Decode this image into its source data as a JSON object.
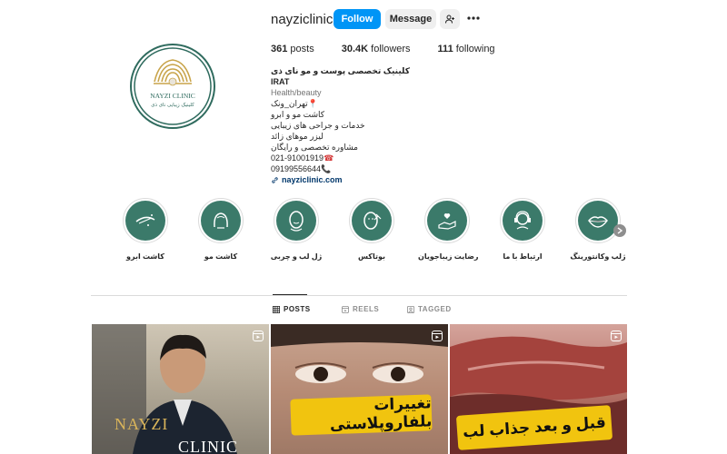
{
  "profile": {
    "username": "nayziclinic",
    "follow_label": "Follow",
    "message_label": "Message"
  },
  "stats": {
    "posts_num": "361",
    "posts_label": "posts",
    "followers_num": "30.4K",
    "followers_label": "followers",
    "following_num": "111",
    "following_label": "following"
  },
  "avatar": {
    "logo_line1": "NAYZI CLINIC",
    "logo_line2": "کلینیک زیبایی نای ذی"
  },
  "bio": {
    "name": "کلینیک تخصصی پوست و مو نای ذی IRAT",
    "category": "Health/beauty",
    "lines": [
      "تهران_ونک",
      "کاشت مو و ابرو",
      "خدمات و جراحی های زیبایی",
      "لیزر موهای زائد",
      "مشاوره تخصصی و رایگان",
      "021-91001919",
      "09199556644"
    ],
    "pin_emoji": "📍",
    "phone_emoji_1": "☎",
    "phone_emoji_2": "📞",
    "link": "nayziclinic.com"
  },
  "highlights": [
    {
      "label": "کاشت ابرو",
      "icon": "eyebrow-icon"
    },
    {
      "label": "کاشت مو",
      "icon": "hair-icon"
    },
    {
      "label": "ژل لب و چربی",
      "icon": "face-icon"
    },
    {
      "label": "بوتاکس",
      "icon": "botox-icon"
    },
    {
      "label": "رضایت زیباجویان",
      "icon": "hand-heart-icon"
    },
    {
      "label": "ارتباط با ما",
      "icon": "contact-icon"
    },
    {
      "label": "ژلب وکانتورینگ",
      "icon": "lips-icon"
    }
  ],
  "tabs": {
    "posts": "POSTS",
    "reels": "REELS",
    "tagged": "TAGGED"
  },
  "posts": {
    "p1_text_a": "NAYZI",
    "p1_text_b": "CLINIC",
    "p2_text": "تغییرات بلفاروپلاستی",
    "p3_text": "قبل و بعد جذاب لب"
  },
  "colors": {
    "accent": "#0095f6",
    "highlight_bg": "#3b7a6a",
    "link": "#00376b",
    "strip": "#f1c40f"
  }
}
